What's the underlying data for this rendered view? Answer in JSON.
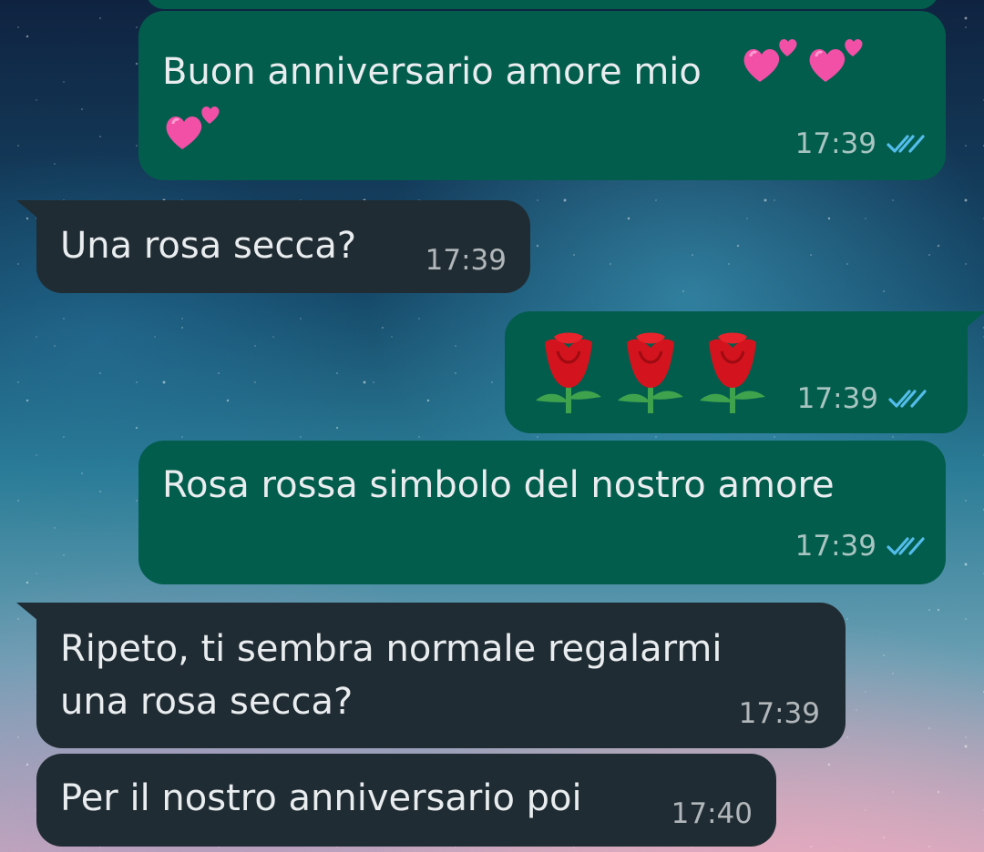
{
  "chat": {
    "messages": [
      {
        "direction": "outgoing",
        "text": "Buon anniversario amore mio",
        "emoji": [
          "two-hearts",
          "two-hearts",
          "two-hearts"
        ],
        "time": "17:39",
        "status": "read"
      },
      {
        "direction": "incoming",
        "text": "Una rosa secca?",
        "time": "17:39"
      },
      {
        "direction": "outgoing",
        "text": "",
        "emoji": [
          "rose",
          "rose",
          "rose"
        ],
        "time": "17:39",
        "status": "read"
      },
      {
        "direction": "outgoing",
        "text": "Rosa rossa simbolo del nostro amore",
        "time": "17:39",
        "status": "read"
      },
      {
        "direction": "incoming",
        "text_line1": "Ripeto, ti sembra normale regalarmi",
        "text_line2": "una rosa secca?",
        "time": "17:39"
      },
      {
        "direction": "incoming",
        "text": "Per il nostro anniversario poi",
        "time": "17:40"
      }
    ]
  },
  "colors": {
    "outgoing_bubble": "#035d4d",
    "incoming_bubble": "#202c33",
    "read_ticks": "#53bdeb",
    "text": "#e9edef"
  },
  "icons": {
    "read_receipt": "double-check-icon",
    "heart_emoji": "two-hearts-icon",
    "rose_emoji": "rose-icon"
  }
}
